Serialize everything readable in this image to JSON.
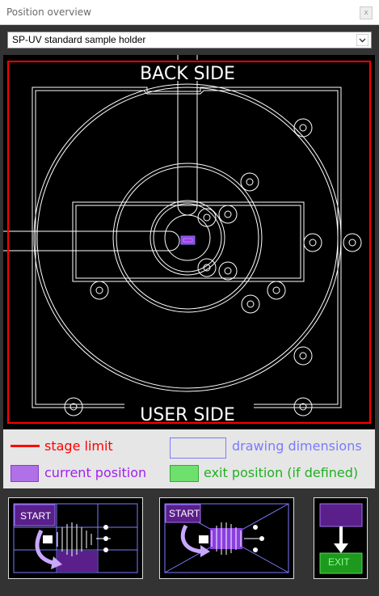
{
  "window": {
    "title": "Position overview",
    "close_label": "x"
  },
  "holder_select": {
    "value": "SP-UV standard sample holder"
  },
  "stage": {
    "back_label": "BACK SIDE",
    "user_label": "USER SIDE",
    "limit_color": "#ff0000"
  },
  "legend": {
    "stage_limit": "stage limit",
    "drawing_dimensions": "drawing dimensions",
    "current_position": "current position",
    "exit_position": "exit position (if defined)"
  },
  "buttons": {
    "start_label_1": "START",
    "start_label_2": "START",
    "exit_label": "EXIT"
  },
  "colors": {
    "accent_red": "#ff0000",
    "current_purple": "#b070e8",
    "exit_green": "#55dd55",
    "drawing_blue": "#7a7aff"
  }
}
